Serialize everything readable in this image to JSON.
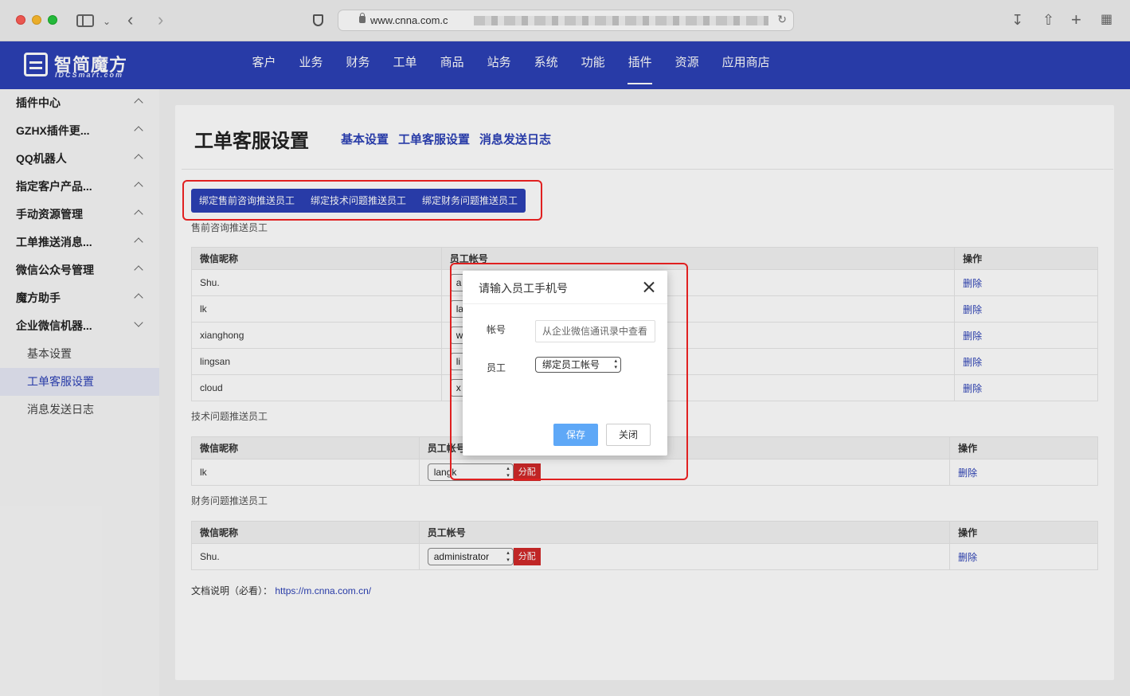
{
  "browser": {
    "url": "www.cnna.com.c"
  },
  "header": {
    "logo_text": "智简魔方",
    "logo_sub": "IDCSmart.com",
    "nav": [
      "客户",
      "业务",
      "财务",
      "工单",
      "商品",
      "站务",
      "系统",
      "功能",
      "插件",
      "资源",
      "应用商店"
    ],
    "active_nav": "插件"
  },
  "sidebar": {
    "items": [
      {
        "label": "插件中心",
        "expanded": false
      },
      {
        "label": "GZHX插件更...",
        "expanded": false
      },
      {
        "label": "QQ机器人",
        "expanded": false
      },
      {
        "label": "指定客户产品...",
        "expanded": false
      },
      {
        "label": "手动资源管理",
        "expanded": false
      },
      {
        "label": "工单推送消息...",
        "expanded": false
      },
      {
        "label": "微信公众号管理",
        "expanded": false
      },
      {
        "label": "魔方助手",
        "expanded": false
      },
      {
        "label": "企业微信机器...",
        "expanded": true
      }
    ],
    "subitems": [
      "基本设置",
      "工单客服设置",
      "消息发送日志"
    ],
    "active_subitem": "工单客服设置"
  },
  "page": {
    "title": "工单客服设置",
    "tabs": [
      "基本设置",
      "工单客服设置",
      "消息发送日志"
    ],
    "button_group": [
      "绑定售前咨询推送员工",
      "绑定技术问题推送员工",
      "绑定财务问题推送员工"
    ],
    "sections": [
      {
        "label": "售前咨询推送员工",
        "columns": [
          "微信昵称",
          "员工帐号",
          "操作"
        ],
        "rows": [
          {
            "nickname": "Shu.",
            "account": "a",
            "action": "删除"
          },
          {
            "nickname": "lk",
            "account": "la",
            "action": "删除"
          },
          {
            "nickname": "xianghong",
            "account": "w",
            "action": "删除"
          },
          {
            "nickname": "lingsan",
            "account": "li",
            "action": "删除"
          },
          {
            "nickname": "cloud",
            "account": "x",
            "action": "删除"
          }
        ]
      },
      {
        "label": "技术问题推送员工",
        "columns": [
          "微信昵称",
          "员工帐号",
          "操作"
        ],
        "rows": [
          {
            "nickname": "lk",
            "account": "langk",
            "assign": "分配",
            "action": "删除"
          }
        ]
      },
      {
        "label": "财务问题推送员工",
        "columns": [
          "微信昵称",
          "员工帐号",
          "操作"
        ],
        "rows": [
          {
            "nickname": "Shu.",
            "account": "administrator",
            "assign": "分配",
            "action": "删除"
          }
        ]
      }
    ],
    "doc_label": "文档说明（必看）：",
    "doc_link": "https://m.cnna.com.cn/"
  },
  "modal": {
    "title": "请输入员工手机号",
    "account_label": "帐号",
    "account_placeholder": "从企业微信通讯录中查看",
    "staff_label": "员工",
    "staff_select": "绑定员工帐号",
    "save_label": "保存",
    "close_label": "关闭"
  },
  "colors": {
    "brand": "#2c41b6",
    "danger": "#d12a2a",
    "save": "#5ea8f7",
    "highlight": "#e02020"
  }
}
